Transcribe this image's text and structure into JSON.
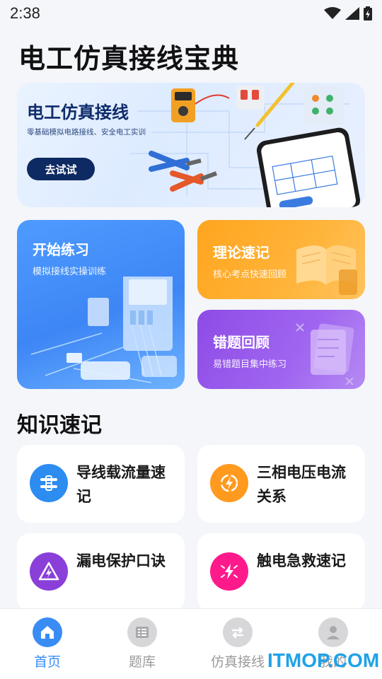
{
  "status_bar": {
    "time": "2:38"
  },
  "app_title": "电工仿真接线宝典",
  "banner": {
    "title": "电工仿真接线",
    "subtitle": "零基础模拟电路接线、安全电工实训",
    "button_label": "去试试"
  },
  "feature_cards": {
    "practice": {
      "title": "开始练习",
      "subtitle": "模拟接线实操训练"
    },
    "theory": {
      "title": "理论速记",
      "subtitle": "核心考点快速回顾"
    },
    "review": {
      "title": "错题回顾",
      "subtitle": "易错题目集中练习"
    }
  },
  "knowledge": {
    "section_title": "知识速记",
    "items": [
      {
        "label": "导线载流量速记",
        "icon": "wire-icon",
        "color": "#2D8CF0"
      },
      {
        "label": "三相电压电流关系",
        "icon": "lightning-circle-icon",
        "color": "#FF9A1F"
      },
      {
        "label": "漏电保护口诀",
        "icon": "warning-bolt-icon",
        "color": "#8A3FD9"
      },
      {
        "label": "触电急救速记",
        "icon": "electric-shock-icon",
        "color": "#FF1A8C"
      }
    ]
  },
  "bottom_nav": {
    "items": [
      {
        "label": "首页",
        "icon": "home-icon",
        "active": true
      },
      {
        "label": "题库",
        "icon": "list-icon",
        "active": false
      },
      {
        "label": "仿真接线",
        "icon": "swap-icon",
        "active": false
      },
      {
        "label": "我的",
        "icon": "user-icon",
        "active": false
      }
    ]
  },
  "watermark": "ITMOP.COM",
  "colors": {
    "accent": "#3A8CF5",
    "banner_button": "#0E2A63"
  }
}
